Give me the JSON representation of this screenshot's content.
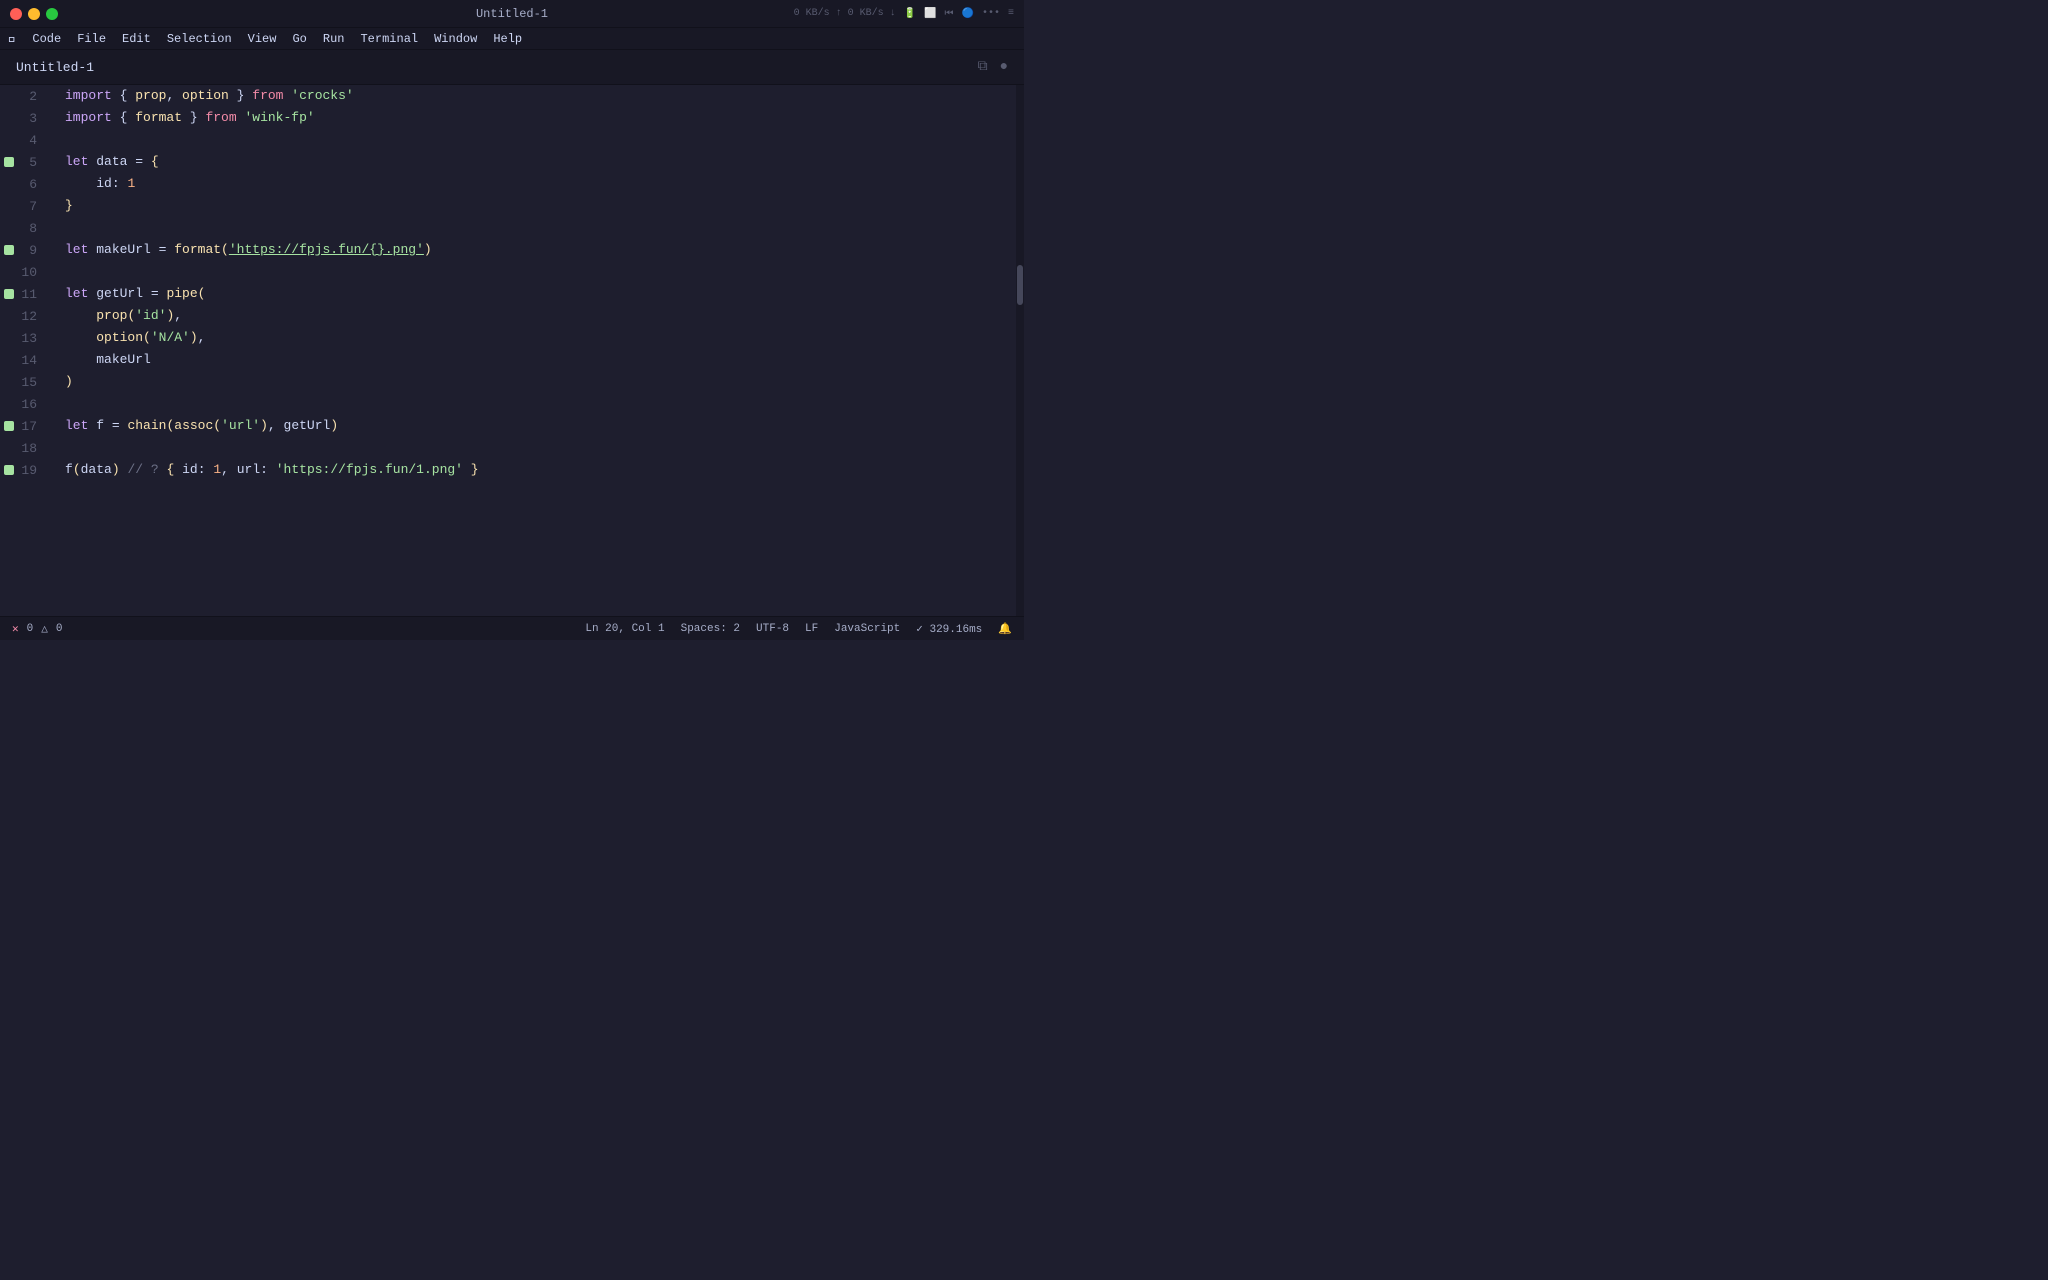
{
  "titlebar": {
    "title": "Untitled-1",
    "dots": [
      "red",
      "yellow",
      "green"
    ]
  },
  "menubar": {
    "apple": "🍎",
    "items": [
      "Code",
      "File",
      "Edit",
      "Selection",
      "View",
      "Go",
      "Run",
      "Terminal",
      "Window",
      "Help"
    ]
  },
  "tab": {
    "title": "Untitled-1"
  },
  "code": {
    "lines": [
      {
        "num": 2,
        "dot": false,
        "content": "import_line1"
      },
      {
        "num": 3,
        "dot": false,
        "content": "import_line2"
      },
      {
        "num": 4,
        "dot": false,
        "content": "empty"
      },
      {
        "num": 5,
        "dot": true,
        "content": "let_data_open"
      },
      {
        "num": 6,
        "dot": false,
        "content": "id_line"
      },
      {
        "num": 7,
        "dot": false,
        "content": "close_brace"
      },
      {
        "num": 8,
        "dot": false,
        "content": "empty"
      },
      {
        "num": 9,
        "dot": true,
        "content": "let_makeurl"
      },
      {
        "num": 10,
        "dot": false,
        "content": "empty"
      },
      {
        "num": 11,
        "dot": true,
        "content": "let_geturl"
      },
      {
        "num": 12,
        "dot": false,
        "content": "prop_id"
      },
      {
        "num": 13,
        "dot": false,
        "content": "option_na"
      },
      {
        "num": 14,
        "dot": false,
        "content": "makeurl"
      },
      {
        "num": 15,
        "dot": false,
        "content": "close_paren"
      },
      {
        "num": 16,
        "dot": false,
        "content": "empty"
      },
      {
        "num": 17,
        "dot": true,
        "content": "let_f"
      },
      {
        "num": 18,
        "dot": false,
        "content": "empty"
      },
      {
        "num": 19,
        "dot": true,
        "content": "f_data"
      }
    ]
  },
  "statusbar": {
    "errors": "0",
    "warnings": "0",
    "position": "Ln 20, Col 1",
    "spaces": "Spaces: 2",
    "encoding": "UTF-8",
    "eol": "LF",
    "language": "JavaScript",
    "timing": "✓ 329.16ms"
  }
}
